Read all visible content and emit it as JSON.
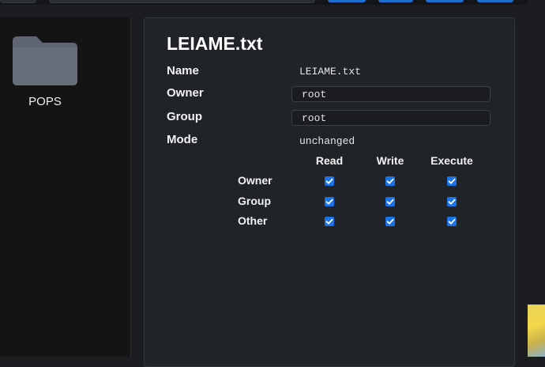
{
  "folder": {
    "label": "POPS",
    "icon": "folder-icon"
  },
  "properties": {
    "title": "LEIAME.txt",
    "name_label": "Name",
    "name_value": "LEIAME.txt",
    "owner_label": "Owner",
    "owner_value": "root",
    "group_label": "Group",
    "group_value": "root",
    "mode_label": "Mode",
    "mode_value": "unchanged"
  },
  "permissions": {
    "columns": [
      "Read",
      "Write",
      "Execute"
    ],
    "rows": [
      {
        "label": "Owner",
        "read": true,
        "write": true,
        "execute": true
      },
      {
        "label": "Group",
        "read": true,
        "write": true,
        "execute": true
      },
      {
        "label": "Other",
        "read": true,
        "write": true,
        "execute": true
      }
    ]
  },
  "colors": {
    "accent": "#1a73e8",
    "panel_bg": "#202327",
    "sidebar_bg": "#141414"
  }
}
